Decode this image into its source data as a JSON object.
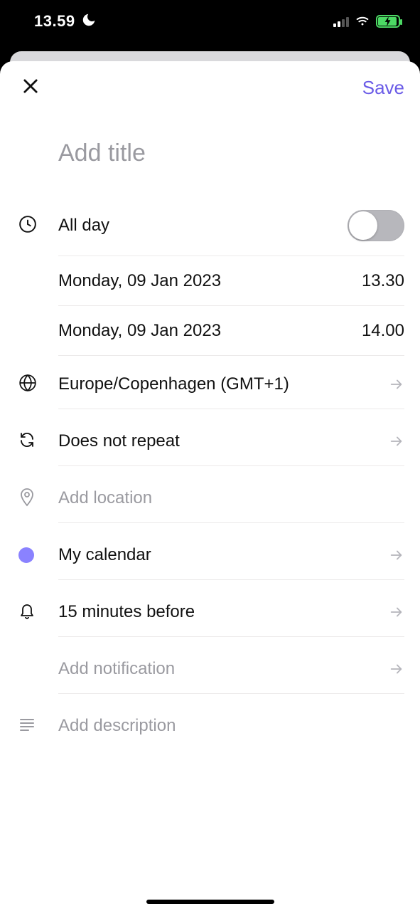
{
  "statusbar": {
    "time": "13.59"
  },
  "header": {
    "save": "Save"
  },
  "title": {
    "placeholder": "Add title"
  },
  "fields": {
    "all_day": "All day",
    "start_date": "Monday, 09 Jan 2023",
    "start_time": "13.30",
    "end_date": "Monday, 09 Jan 2023",
    "end_time": "14.00",
    "timezone": "Europe/Copenhagen (GMT+1)",
    "repeat": "Does not repeat",
    "location_placeholder": "Add location",
    "calendar": "My calendar",
    "notification": "15 minutes before",
    "add_notification": "Add notification",
    "description_placeholder": "Add description"
  },
  "colors": {
    "accent": "#6b5ce7",
    "calendar_dot": "#8a82ff"
  }
}
